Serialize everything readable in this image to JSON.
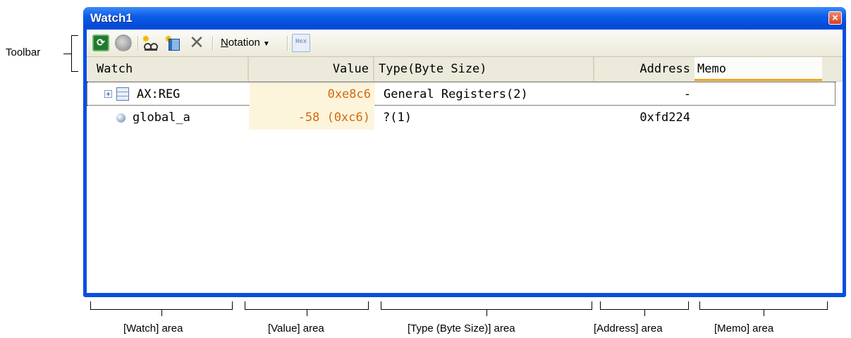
{
  "window": {
    "title": "Watch1"
  },
  "toolbar": {
    "notation_label": "Notation",
    "notation_mnemonic": "N",
    "notation_rest": "otation",
    "hex_label": "Hex",
    "icons": [
      "refresh-icon",
      "gear-icon",
      "add-watch-icon",
      "add-category-icon",
      "delete-icon",
      "hex-toggle-icon"
    ]
  },
  "columns": {
    "watch": "Watch",
    "value": "Value",
    "type": "Type(Byte Size)",
    "address": "Address",
    "memo": "Memo"
  },
  "rows": [
    {
      "watch": "AX:REG",
      "value": "0xe8c6",
      "type": "General Registers(2)",
      "address": "-",
      "memo": ""
    },
    {
      "watch": "global_a",
      "value": "-58 (0xc6)",
      "type": "?(1)",
      "address": "0xfd224",
      "memo": ""
    }
  ],
  "annotations": {
    "toolbar": "Toolbar",
    "watch_area": "[Watch] area",
    "value_area": "[Value] area",
    "type_area": "[Type (Byte Size)] area",
    "address_area": "[Address] area",
    "memo_area": "[Memo] area"
  },
  "colors": {
    "titlebar": "#0a5ce8",
    "value_text": "#d06a10",
    "value_bg": "#fdf4dc",
    "memo_underline": "#f5a623"
  }
}
